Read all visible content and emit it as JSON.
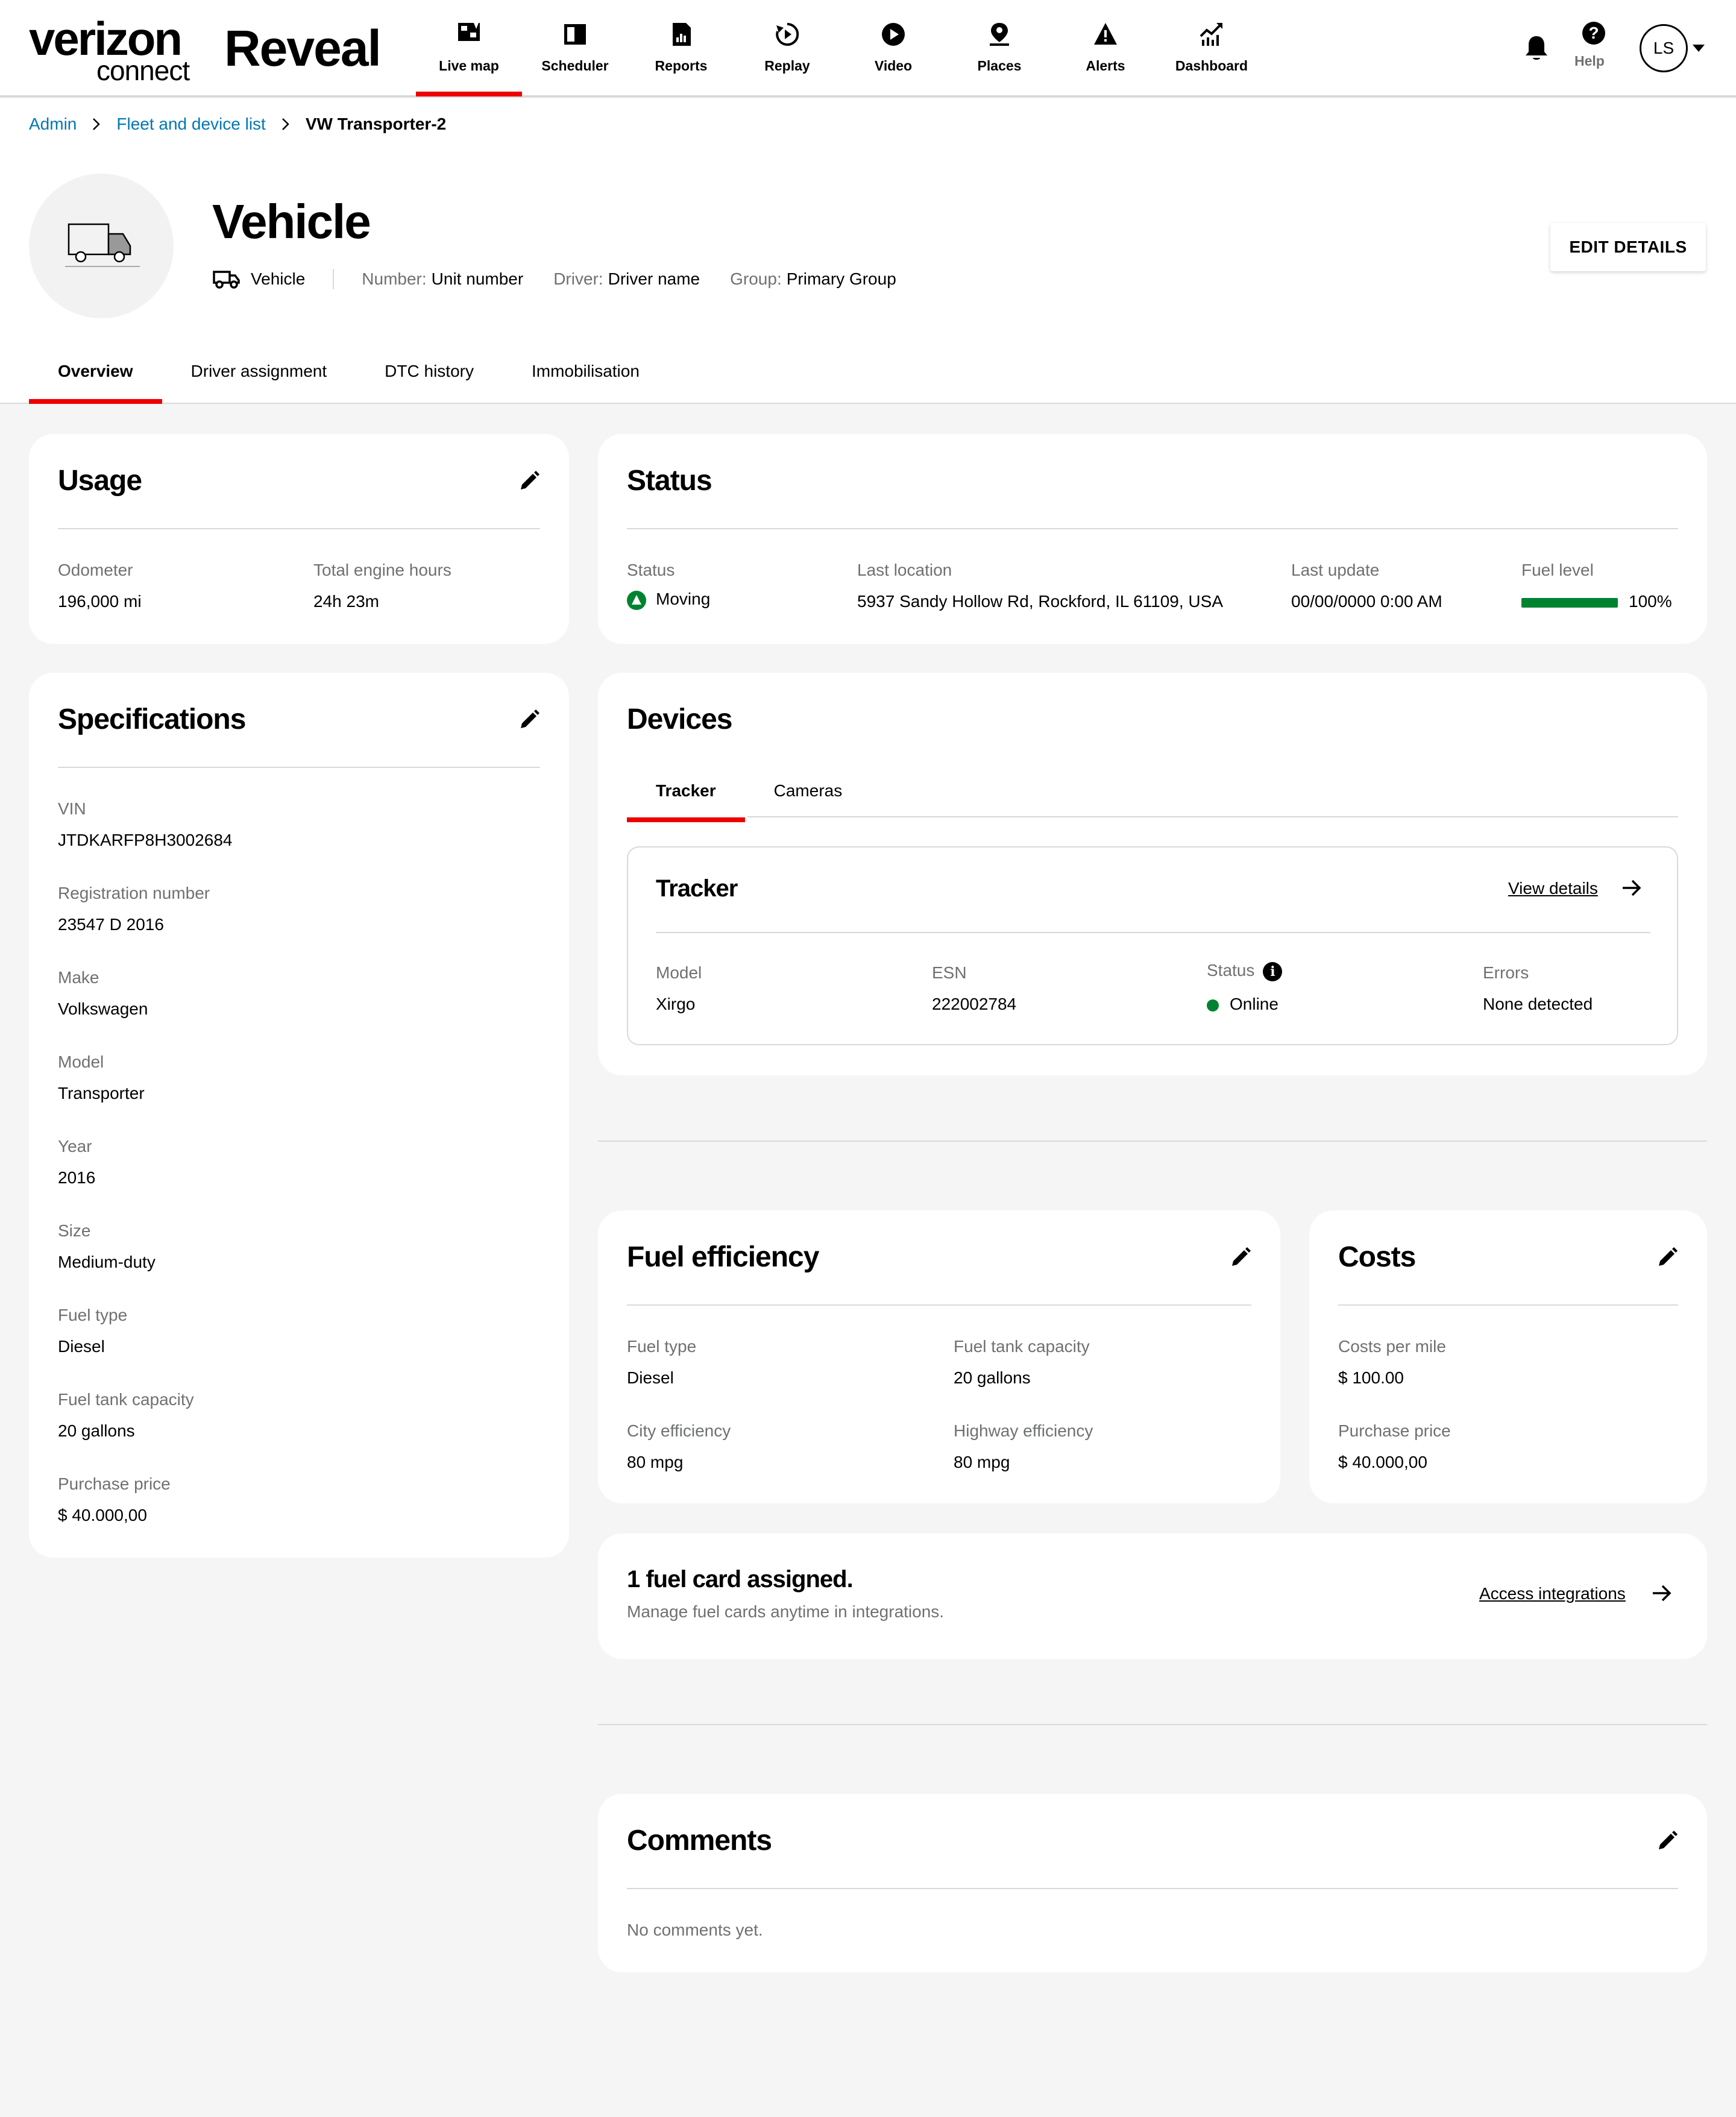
{
  "header": {
    "brand": "verizon",
    "brand_sub": "connect",
    "product": "Reveal",
    "nav": [
      {
        "label": "Live map",
        "icon": "live-map-icon",
        "active": true
      },
      {
        "label": "Scheduler",
        "icon": "scheduler-icon",
        "active": false
      },
      {
        "label": "Reports",
        "icon": "reports-icon",
        "active": false
      },
      {
        "label": "Replay",
        "icon": "replay-icon",
        "active": false
      },
      {
        "label": "Video",
        "icon": "video-icon",
        "active": false
      },
      {
        "label": "Places",
        "icon": "places-icon",
        "active": false
      },
      {
        "label": "Alerts",
        "icon": "alerts-icon",
        "active": false
      },
      {
        "label": "Dashboard",
        "icon": "dashboard-icon",
        "active": false
      }
    ],
    "help_label": "Help",
    "help_glyph": "?",
    "user_initials": "LS"
  },
  "breadcrumb": {
    "items": [
      "Admin",
      "Fleet and device list"
    ],
    "current": "VW Transporter-2"
  },
  "vehicle": {
    "title": "Vehicle",
    "type_label": "Vehicle",
    "number_key": "Number:",
    "number_value": "Unit number",
    "driver_key": "Driver:",
    "driver_value": "Driver name",
    "group_key": "Group:",
    "group_value": "Primary Group",
    "edit_button": "EDIT DETAILS"
  },
  "tabs": [
    "Overview",
    "Driver assignment",
    "DTC history",
    "Immobilisation"
  ],
  "usage": {
    "title": "Usage",
    "odometer_label": "Odometer",
    "odometer_value": "196,000 mi",
    "engine_hours_label": "Total engine hours",
    "engine_hours_value": "24h 23m"
  },
  "status": {
    "title": "Status",
    "status_label": "Status",
    "status_value": "Moving",
    "location_label": "Last location",
    "location_value": "5937 Sandy Hollow Rd, Rockford, IL 61109, USA",
    "update_label": "Last update",
    "update_value": "00/00/0000 0:00 AM",
    "fuel_label": "Fuel level",
    "fuel_value": "100%",
    "fuel_fraction": 1.0,
    "colors": {
      "ok": "#008331"
    }
  },
  "specifications": {
    "title": "Specifications",
    "fields": [
      {
        "label": "VIN",
        "value": "JTDKARFP8H3002684"
      },
      {
        "label": "Registration number",
        "value": "23547 D 2016"
      },
      {
        "label": "Make",
        "value": "Volkswagen"
      },
      {
        "label": "Model",
        "value": "Transporter"
      },
      {
        "label": "Year",
        "value": "2016"
      },
      {
        "label": "Size",
        "value": "Medium-duty"
      },
      {
        "label": "Fuel type",
        "value": "Diesel"
      },
      {
        "label": "Fuel tank capacity",
        "value": "20 gallons"
      },
      {
        "label": "Purchase price",
        "value": "$ 40.000,00"
      }
    ]
  },
  "devices": {
    "title": "Devices",
    "tabs": [
      "Tracker",
      "Cameras"
    ],
    "tracker": {
      "title": "Tracker",
      "view_details": "View details",
      "model_label": "Model",
      "model_value": "Xirgo",
      "esn_label": "ESN",
      "esn_value": "222002784",
      "status_label": "Status",
      "status_value": "Online",
      "errors_label": "Errors",
      "errors_value": "None detected"
    }
  },
  "fuel_efficiency": {
    "title": "Fuel efficiency",
    "fuel_type_label": "Fuel type",
    "fuel_type_value": "Diesel",
    "tank_label": "Fuel tank capacity",
    "tank_value": "20 gallons",
    "city_label": "City efficiency",
    "city_value": "80 mpg",
    "highway_label": "Highway efficiency",
    "highway_value": "80 mpg"
  },
  "costs": {
    "title": "Costs",
    "per_mile_label": "Costs per mile",
    "per_mile_value": "$ 100.00",
    "purchase_label": "Purchase price",
    "purchase_value": "$ 40.000,00"
  },
  "fuel_card": {
    "title": "1 fuel card assigned.",
    "subtitle": "Manage fuel cards anytime in integrations.",
    "link": "Access integrations"
  },
  "comments": {
    "title": "Comments",
    "empty": "No comments yet."
  },
  "theme": {
    "accent": "#ee0000",
    "link": "#0077b4",
    "muted": "#6f7171",
    "border": "#d8dada"
  }
}
